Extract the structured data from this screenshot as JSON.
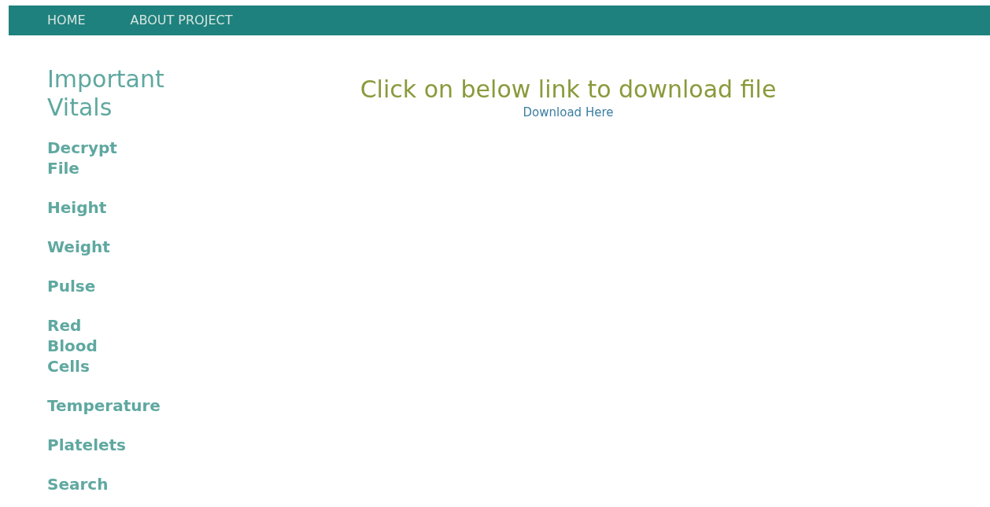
{
  "nav": [
    {
      "label": "HOME"
    },
    {
      "label": "ABOUT PROJECT"
    }
  ],
  "sidebar": {
    "title": "Important Vitals",
    "items": [
      {
        "label": "Decrypt File"
      },
      {
        "label": "Height"
      },
      {
        "label": "Weight"
      },
      {
        "label": "Pulse"
      },
      {
        "label": "Red Blood Cells"
      },
      {
        "label": "Temperature"
      },
      {
        "label": "Platelets"
      },
      {
        "label": "Search"
      }
    ]
  },
  "main": {
    "heading": "Click on below link to download file",
    "link": "Download Here"
  }
}
